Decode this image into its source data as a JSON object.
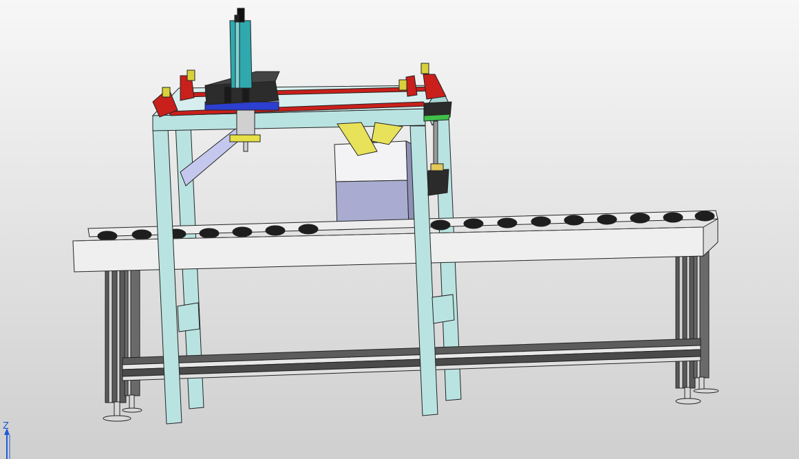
{
  "viewport": {
    "background_top": "#f7f7f7",
    "background_bottom": "#cfcfcf"
  },
  "axis_triad": {
    "label": "Z",
    "color": "#1d5bd6"
  },
  "model": {
    "components": [
      "gantry-frame",
      "roller-conveyor",
      "vertical-linear-actuator",
      "carriage-block",
      "yellow-gripper",
      "box-workpiece",
      "adjustable-feet"
    ],
    "colors": {
      "gantry": "#b9e3e1",
      "rails": "#c9201b",
      "actuator": "#2fa9ae",
      "carriage": "#2c2c2c",
      "clamp_blue": "#2d3fd0",
      "gripper": "#e8e25a",
      "box_top": "#f3f3f6",
      "box_side": "#a9acd0",
      "conveyor": "#efefef",
      "roller": "#1e1e1e",
      "leg_profile": "#555555"
    }
  }
}
